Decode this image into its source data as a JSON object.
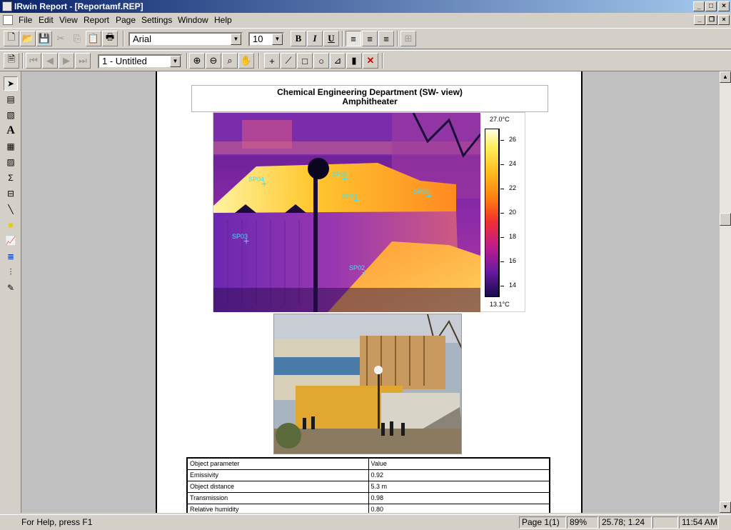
{
  "window": {
    "title": "IRwin Report - [Reportamf.REP]"
  },
  "menu": [
    "File",
    "Edit",
    "View",
    "Report",
    "Page",
    "Settings",
    "Window",
    "Help"
  ],
  "format_toolbar": {
    "font": "Arial",
    "size": "10",
    "bold": "B",
    "italic": "I",
    "underline": "U"
  },
  "nav_toolbar": {
    "page_select": "1 - Untitled"
  },
  "report": {
    "title_line1": "Chemical Engineering Department (SW- view)",
    "title_line2": "Amphitheater",
    "scale_max": "27.0°C",
    "scale_min": "13.1°C",
    "scale_ticks": [
      "26",
      "24",
      "22",
      "20",
      "18",
      "16",
      "14"
    ],
    "spots": [
      "SP01",
      "SP02",
      "SP03",
      "SP04",
      "SP05",
      "SP06"
    ],
    "params_header": [
      "Object parameter",
      "Value"
    ],
    "params": [
      {
        "name": "Emissivity",
        "value": "0.92"
      },
      {
        "name": "Object distance",
        "value": "5.3 m"
      },
      {
        "name": "Transmission",
        "value": "0.98"
      },
      {
        "name": "Relative humidity",
        "value": "0.80"
      }
    ]
  },
  "status": {
    "help": "For Help, press F1",
    "page": "Page 1(1)",
    "zoom": "89%",
    "coords": "25.78; 1.24",
    "time": "11:54 AM"
  }
}
